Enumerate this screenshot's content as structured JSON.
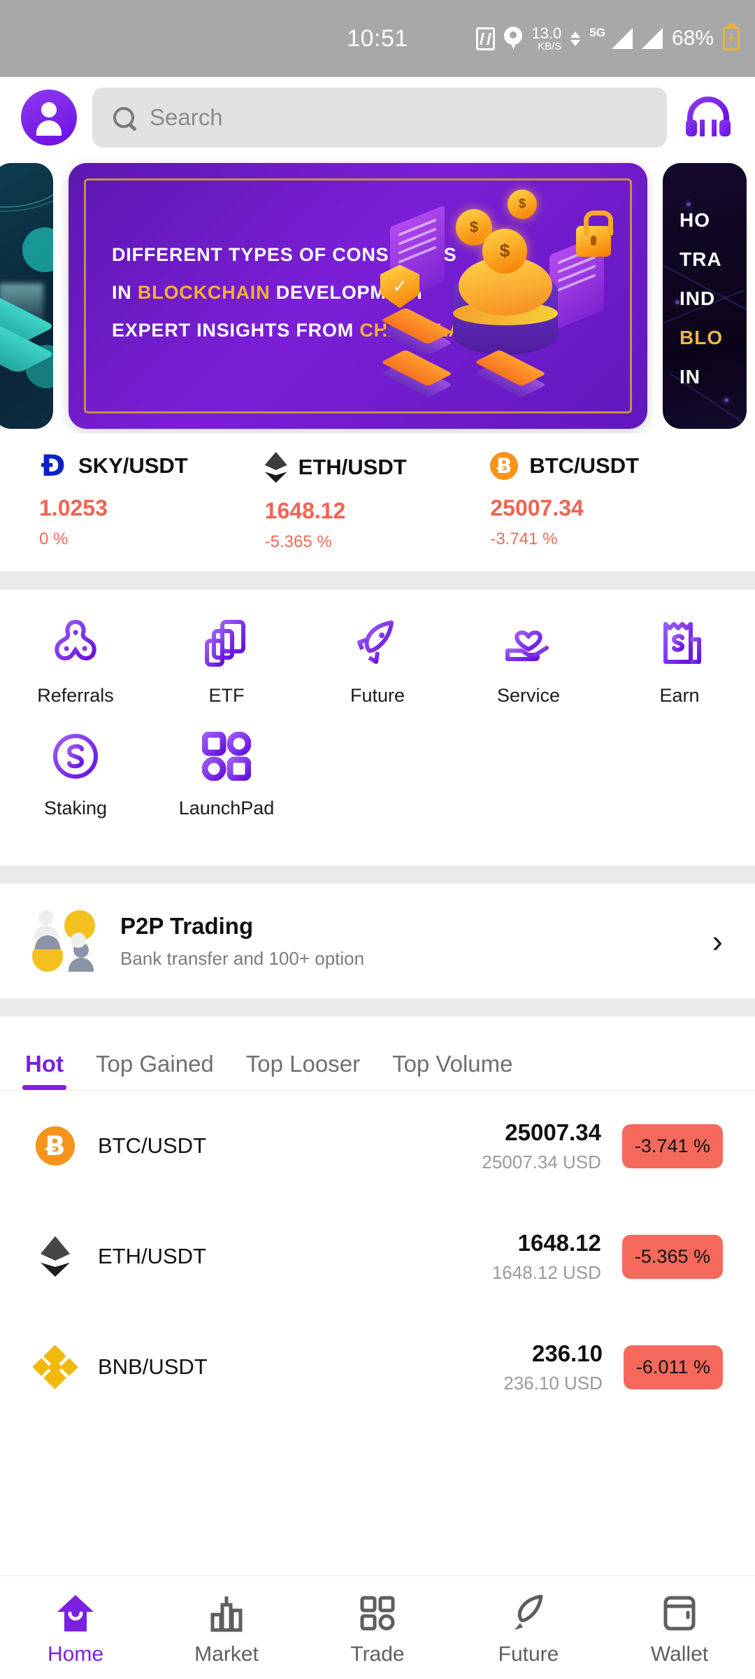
{
  "status_bar": {
    "time": "10:51",
    "nfc_icon": "nfc-icon",
    "location_icon": "location-pin-icon",
    "net_speed_value": "13.0",
    "net_speed_unit": "KB/S",
    "network_type": "5G",
    "battery_percent": "68%",
    "battery_icon": "battery-charging-icon"
  },
  "header": {
    "avatar_icon": "user-avatar-icon",
    "search": {
      "placeholder": "Search",
      "value": "",
      "icon": "search-icon"
    },
    "support_icon": "headphones-icon"
  },
  "banners": {
    "left": {
      "theme_color": "#0d2f42",
      "art": "isometric-blocks"
    },
    "active": {
      "line1": "DIFFERENT TYPES OF CONSENSUS",
      "line2_prefix": "IN ",
      "line2_highlight": "BLOCKCHAIN",
      "line2_suffix": " DEVELOPMENT",
      "line3_prefix": "EXPERT INSIGHTS FROM ",
      "line3_highlight": "CHAINCLAVE",
      "bg_color": "#6a1bc4",
      "accent_color": "#f2b134"
    },
    "right": {
      "line1": "HO",
      "line2": "TRA",
      "line3": "IND",
      "line4": "BLO",
      "line5": "IN ",
      "bg_color": "#100722",
      "accent_color": "#e8b84b"
    }
  },
  "tickers": [
    {
      "icon": "sky-coin-icon",
      "symbol": "Ð",
      "pair": "SKY/USDT",
      "price": "1.0253",
      "change": "0 %"
    },
    {
      "icon": "eth-coin-icon",
      "pair": "ETH/USDT",
      "price": "1648.12",
      "change": "-5.365 %"
    },
    {
      "icon": "btc-coin-icon",
      "symbol": "Ƀ",
      "pair": "BTC/USDT",
      "price": "25007.34",
      "change": "-3.741 %"
    }
  ],
  "quick_actions": [
    {
      "icon": "referrals-icon",
      "label": "Referrals"
    },
    {
      "icon": "etf-icon",
      "label": "ETF"
    },
    {
      "icon": "rocket-future-icon",
      "label": "Future"
    },
    {
      "icon": "service-heart-hand-icon",
      "label": "Service"
    },
    {
      "icon": "earn-receipt-dollar-icon",
      "label": "Earn"
    },
    {
      "icon": "staking-dollar-circle-icon",
      "label": "Staking"
    },
    {
      "icon": "launchpad-grid-icon",
      "label": "LaunchPad"
    }
  ],
  "p2p": {
    "icon": "p2p-people-coins-icon",
    "title": "P2P Trading",
    "subtitle": "Bank transfer and 100+ option",
    "chevron_icon": "chevron-right-icon"
  },
  "market_tabs": [
    {
      "label": "Hot",
      "active": true
    },
    {
      "label": "Top Gained",
      "active": false
    },
    {
      "label": "Top Looser",
      "active": false
    },
    {
      "label": "Top Volume",
      "active": false
    }
  ],
  "market_rows": [
    {
      "icon": "btc-coin-icon",
      "symbol": "Ƀ",
      "pair": "BTC/USDT",
      "price": "25007.34",
      "usd": "25007.34 USD",
      "change": "-3.741 %"
    },
    {
      "icon": "eth-coin-icon",
      "pair": "ETH/USDT",
      "price": "1648.12",
      "usd": "1648.12 USD",
      "change": "-5.365 %"
    },
    {
      "icon": "bnb-coin-icon",
      "pair": "BNB/USDT",
      "price": "236.10",
      "usd": "236.10 USD",
      "change": "-6.011 %"
    }
  ],
  "bottom_nav": [
    {
      "icon": "home-icon",
      "label": "Home",
      "active": true
    },
    {
      "icon": "market-bars-icon",
      "label": "Market",
      "active": false
    },
    {
      "icon": "trade-grid-icon",
      "label": "Trade",
      "active": false
    },
    {
      "icon": "future-rocket-icon",
      "label": "Future",
      "active": false
    },
    {
      "icon": "wallet-icon",
      "label": "Wallet",
      "active": false
    }
  ],
  "colors": {
    "brand_purple": "#7b1fe0",
    "negative_red": "#f06350",
    "chip_red": "#f4695c",
    "divider_gray": "#eaeaea",
    "btc_orange": "#f7931a",
    "bnb_yellow": "#f0b90b"
  }
}
